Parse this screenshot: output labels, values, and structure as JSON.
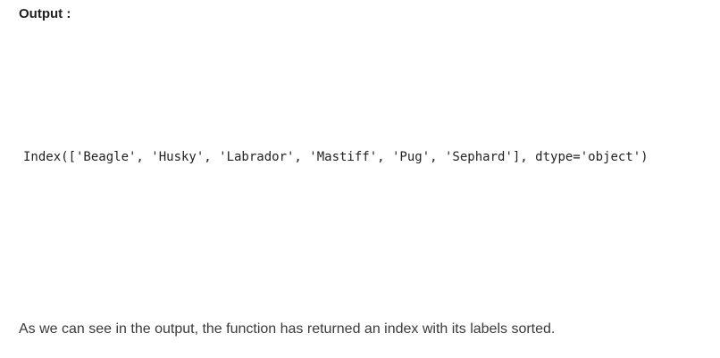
{
  "article": {
    "output_heading": "Output :",
    "code_output": "Index(['Beagle', 'Husky', 'Labrador', 'Mastiff', 'Pug', 'Sephard'], dtype='object')",
    "explanation": "As we can see in the output, the function has returned an index with its labels sorted."
  }
}
